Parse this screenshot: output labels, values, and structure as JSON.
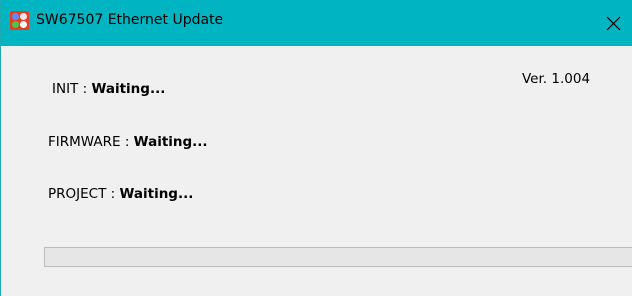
{
  "window": {
    "title": "SW67507 Ethernet Update"
  },
  "version": "Ver. 1.004",
  "status": {
    "init_label": "INIT : ",
    "init_value": "Waiting...",
    "firmware_label": "FIRMWARE : ",
    "firmware_value": "Waiting...",
    "project_label": "PROJECT : ",
    "project_value": "Waiting..."
  },
  "progress": {
    "fraction": 0
  },
  "colors": {
    "titlebar": "#00b4c2",
    "background": "#f0f0f0",
    "progress_track": "#e6e6e6"
  },
  "icons": {
    "app": "app-logo-icon",
    "close": "close-icon"
  }
}
